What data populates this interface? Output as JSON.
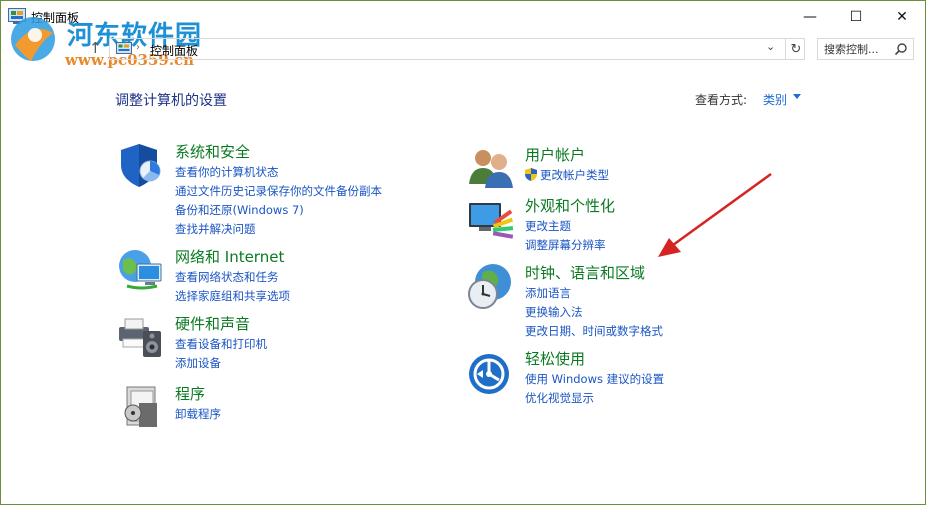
{
  "window": {
    "title": "控制面板",
    "controls": {
      "minimize": "—",
      "maximize": "☐",
      "close": "✕"
    }
  },
  "watermark": {
    "title": "河东软件园",
    "url": "www.pc0359.cn"
  },
  "address_bar": {
    "path": "控制面板",
    "dropdown": "⌄",
    "refresh": "↻",
    "up": "↑"
  },
  "search": {
    "placeholder": "搜索控制..."
  },
  "content": {
    "title": "调整计算机的设置",
    "view_by": {
      "label": "查看方式:",
      "value": "类别"
    }
  },
  "categories": {
    "system": {
      "title": "系统和安全",
      "links": [
        "查看你的计算机状态",
        "通过文件历史记录保存你的文件备份副本",
        "备份和还原(Windows 7)",
        "查找并解决问题"
      ]
    },
    "network": {
      "title": "网络和 Internet",
      "links": [
        "查看网络状态和任务",
        "选择家庭组和共享选项"
      ]
    },
    "hardware": {
      "title": "硬件和声音",
      "links": [
        "查看设备和打印机",
        "添加设备"
      ]
    },
    "programs": {
      "title": "程序",
      "links": [
        "卸载程序"
      ]
    },
    "users": {
      "title": "用户帐户",
      "links": [
        "更改帐户类型"
      ]
    },
    "appearance": {
      "title": "外观和个性化",
      "links": [
        "更改主题",
        "调整屏幕分辨率"
      ]
    },
    "clock": {
      "title": "时钟、语言和区域",
      "links": [
        "添加语言",
        "更换输入法",
        "更改日期、时间或数字格式"
      ]
    },
    "ease": {
      "title": "轻松使用",
      "links": [
        "使用 Windows 建议的设置",
        "优化视觉显示"
      ]
    }
  },
  "colors": {
    "accent_link": "#1a55c4",
    "category_title": "#0a7a21",
    "page_title": "#1e3287",
    "annotation_arrow": "#d42424"
  }
}
